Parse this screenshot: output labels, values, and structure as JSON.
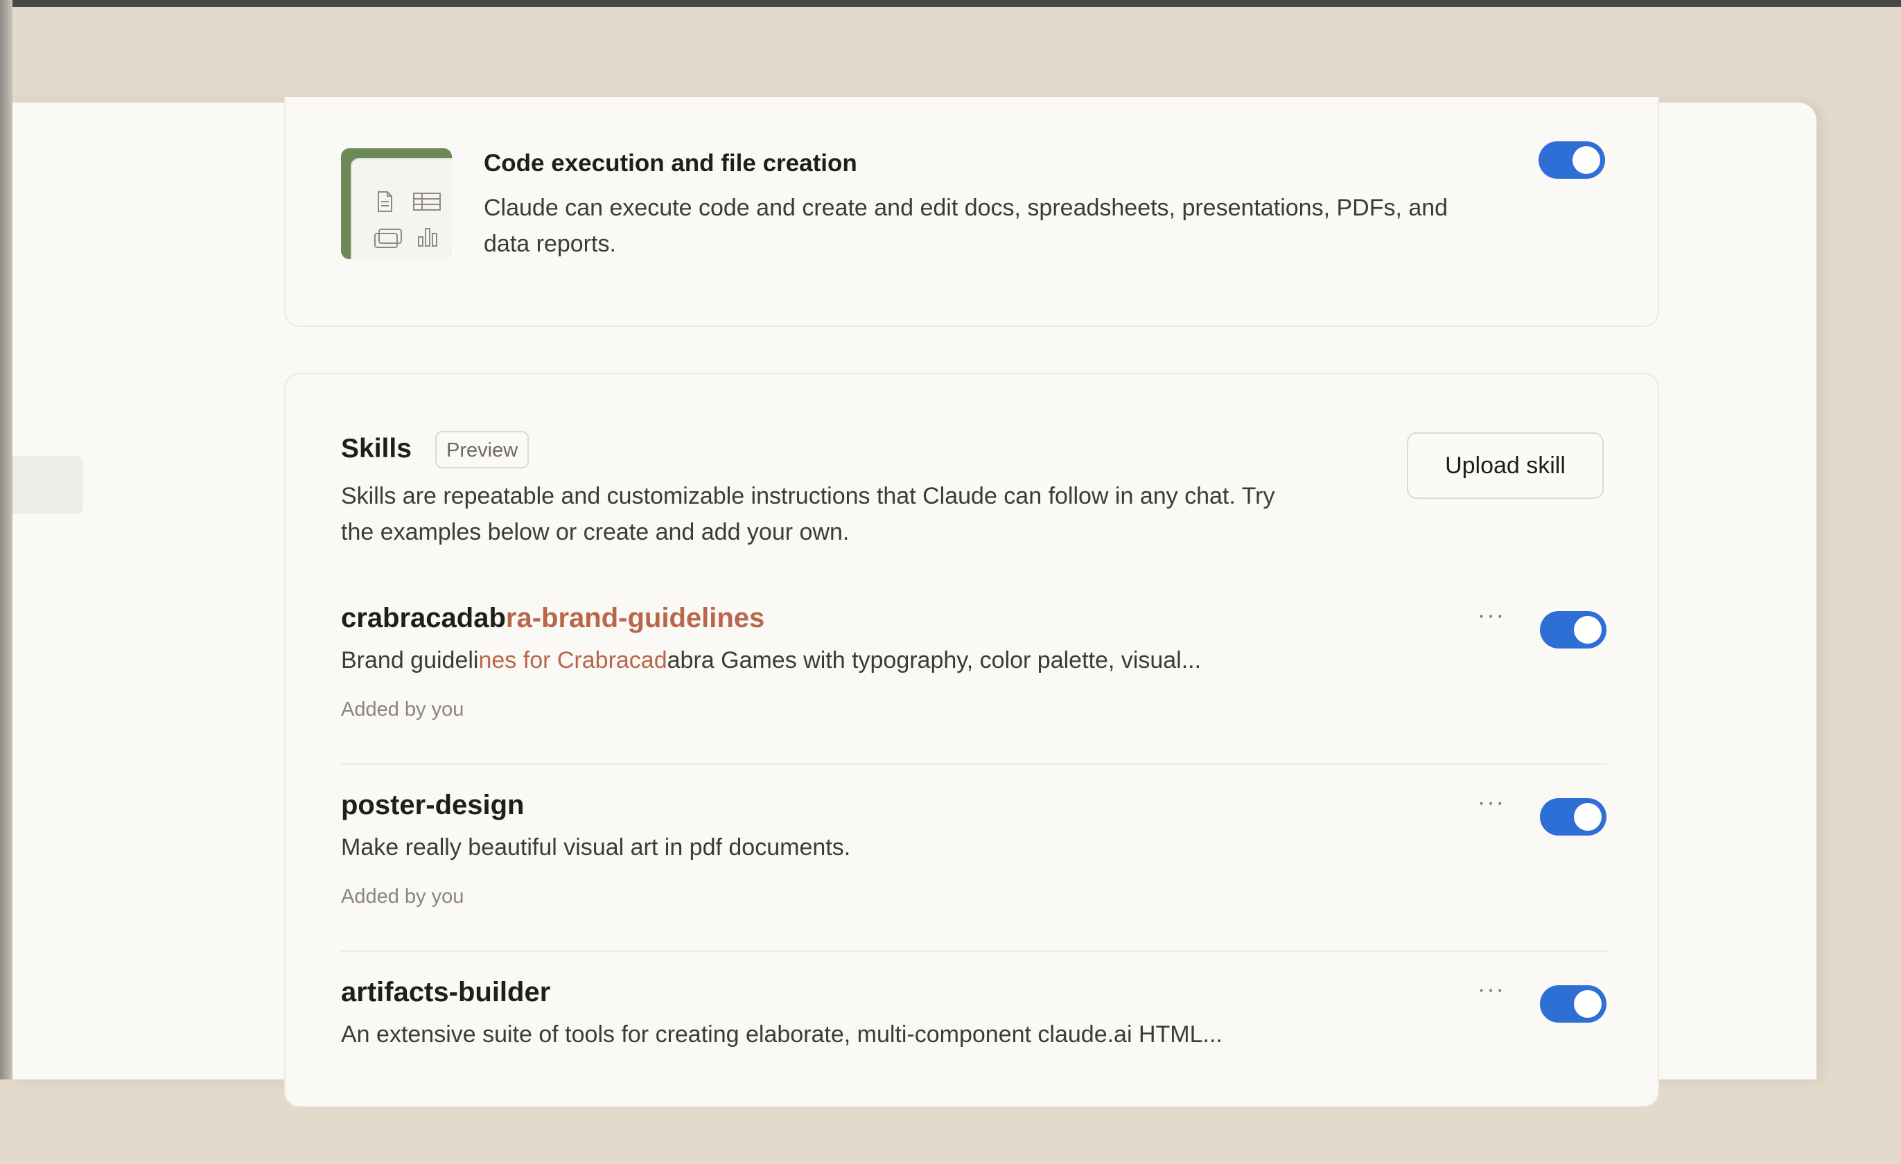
{
  "code_execution": {
    "title": "Code execution and file creation",
    "description": "Claude can execute code and create and edit docs, spreadsheets, presentations, PDFs, and data reports.",
    "enabled": true
  },
  "skills": {
    "title": "Skills",
    "badge": "Preview",
    "description": "Skills are repeatable and customizable instructions that Claude can follow in any chat. Try the examples below or create and add your own.",
    "upload_label": "Upload skill",
    "more_label": "···",
    "items": [
      {
        "name_part1": "crabracadab",
        "name_part2": "ra-brand-guidelines",
        "desc_part1": "Brand guideli",
        "desc_part2": "nes for Crabracad",
        "desc_part3": "abra Games with typography, color palette, visual...",
        "meta": "Added by you",
        "enabled": true
      },
      {
        "name": "poster-design",
        "desc": "Make really beautiful visual art in pdf documents.",
        "meta": "Added by you",
        "enabled": true
      },
      {
        "name": "artifacts-builder",
        "desc": "An extensive suite of tools for creating elaborate, multi-component claude.ai HTML...",
        "enabled": true
      }
    ]
  },
  "colors": {
    "accent": "#2e6fd6",
    "highlight": "#b9664a",
    "background": "#faf9f5",
    "desktop": "#e3dacc"
  }
}
